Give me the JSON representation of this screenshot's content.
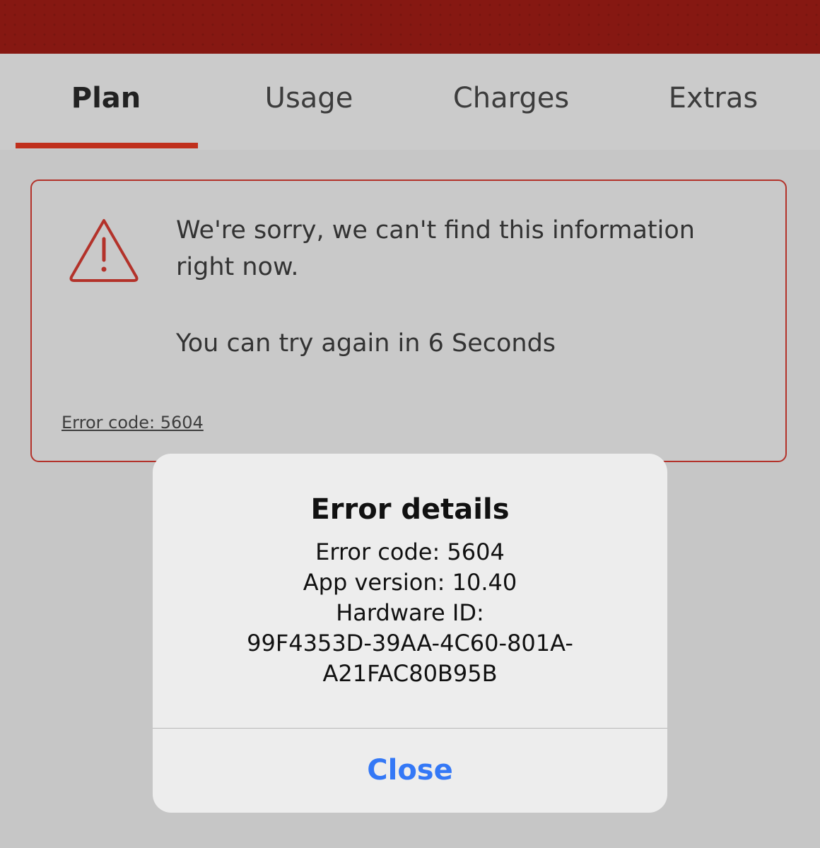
{
  "tabs": [
    {
      "label": "Plan",
      "active": true
    },
    {
      "label": "Usage",
      "active": false
    },
    {
      "label": "Charges",
      "active": false
    },
    {
      "label": "Extras",
      "active": false
    }
  ],
  "error_card": {
    "icon": "warning-triangle-icon",
    "message": "We're sorry, we can't find this information right now.",
    "retry": "You can try again in 6 Seconds",
    "error_code_link": "Error code: 5604"
  },
  "alert": {
    "title": "Error details",
    "lines": [
      "Error code: 5604",
      "App version: 10.40",
      "Hardware ID:",
      "99F4353D-39AA-4C60-801A-",
      "A21FAC80B95B"
    ],
    "close_label": "Close"
  },
  "colors": {
    "brand_red": "#861812",
    "accent_red": "#c0301d",
    "link_blue": "#3478f6"
  }
}
